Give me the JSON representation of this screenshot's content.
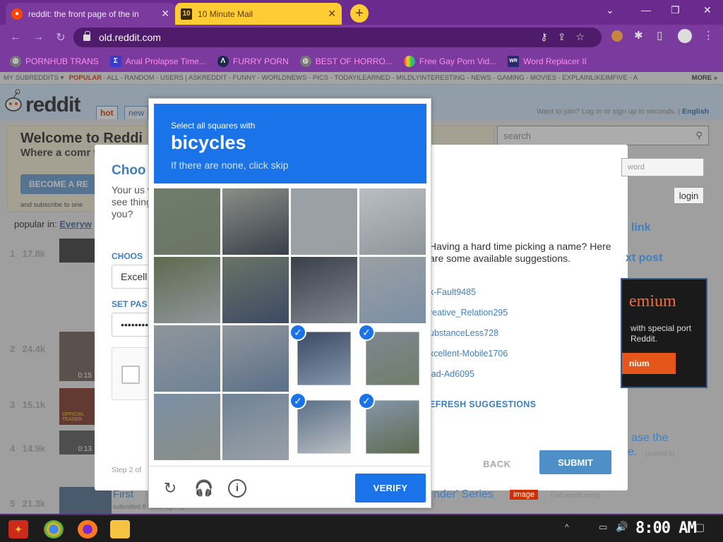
{
  "browser": {
    "tabs": [
      {
        "title": "reddit: the front page of the in",
        "close": "✕"
      },
      {
        "title": "10 Minute Mail",
        "close": "✕"
      }
    ],
    "new_tab": "+",
    "url": "old.reddit.com",
    "bookmarks": [
      {
        "label": "PORNHUB TRANS",
        "icon": "globe-icon"
      },
      {
        "label": "Anal Prolapse Time...",
        "icon": "sigma-icon"
      },
      {
        "label": "FURRY PORN",
        "icon": "lambda-icon"
      },
      {
        "label": "BEST OF HORRO...",
        "icon": "globe-icon"
      },
      {
        "label": "Free Gay Porn Vid...",
        "icon": "rainbow-icon"
      },
      {
        "label": "Word Replacer II",
        "icon": "wr-icon"
      }
    ]
  },
  "reddit": {
    "subreddit_bar": {
      "my": "MY SUBREDDITS ▾",
      "popular": "POPULAR",
      "items": "- ALL - RANDOM - USERS  |  ASKREDDIT - FUNNY - WORLDNEWS - PICS - TODAYILEARNED - MILDLYINTERESTING - NEWS - GAMING - MOVIES - EXPLAINLIKEIMFIVE - A",
      "more": "MORE »"
    },
    "logo_text": "reddit",
    "tabs": {
      "hot": "hot",
      "new": "new"
    },
    "join_line": "Want to join? Log in or sign up in seconds. |",
    "join_lang": "English",
    "welcome": {
      "title": "Welcome to Reddi",
      "text": "Where a comr things is wait",
      "button": "BECOME A RE",
      "sub": "and subscribe to one"
    },
    "search_placeholder": "search",
    "popular_in": "popular in:",
    "popular_loc": "Everyw",
    "posts": [
      {
        "rank": "1",
        "score": "17.8k"
      },
      {
        "rank": "2",
        "score": "24.4k",
        "badge": "0:15"
      },
      {
        "rank": "3",
        "score": "15.1k",
        "badge": "OFFICIAL TEASER"
      },
      {
        "rank": "4",
        "score": "14.9k",
        "badge": "0:13"
      },
      {
        "rank": "5",
        "score": "21.3k",
        "title": "First",
        "subtitle": "submitted 8 hours ago by"
      }
    ],
    "right": {
      "password_placeholder": "word",
      "login": "login",
      "link": "link",
      "text_post": "xt post",
      "premium_title": "emium",
      "premium_text": "with special port Reddit.",
      "premium_button": "nium",
      "bottom_title": "ase the",
      "bottom_sub": "e.",
      "bottom_src": "(v.redd.it)",
      "series": "nder' Series",
      "series_tag": "image",
      "series_src": "(old.reddit.com)"
    }
  },
  "signup_modal": {
    "title": "Choo",
    "text": "Your us will see things y you?",
    "choose_label": "CHOOS",
    "username_value": "Excell",
    "password_label": "SET PAS",
    "password_value": "••••••••",
    "step": "Step 2 of",
    "hint": "Having a hard time picking a name? Here are some available suggestions.",
    "suggestions": [
      "k-Fault9485",
      "reative_Relation295",
      "ubstanceLess728",
      "xcellent-Mobile1706",
      "lad-Ad6095"
    ],
    "refresh": "EFRESH SUGGESTIONS",
    "back": "BACK",
    "submit": "SUBMIT"
  },
  "captcha": {
    "line1": "Select all squares with",
    "target": "bicycles",
    "line3": "If there are none, click skip",
    "selected_tiles": [
      10,
      11,
      14,
      15
    ],
    "verify": "VERIFY",
    "icons": [
      "reload-icon",
      "audio-icon",
      "info-icon"
    ]
  },
  "taskbar": {
    "clock": "8:00 AM"
  },
  "colors": {
    "tabbar": "#6a2a8e",
    "captcha_blue": "#1a73e8",
    "reddit_blue": "#3f7fbf"
  }
}
